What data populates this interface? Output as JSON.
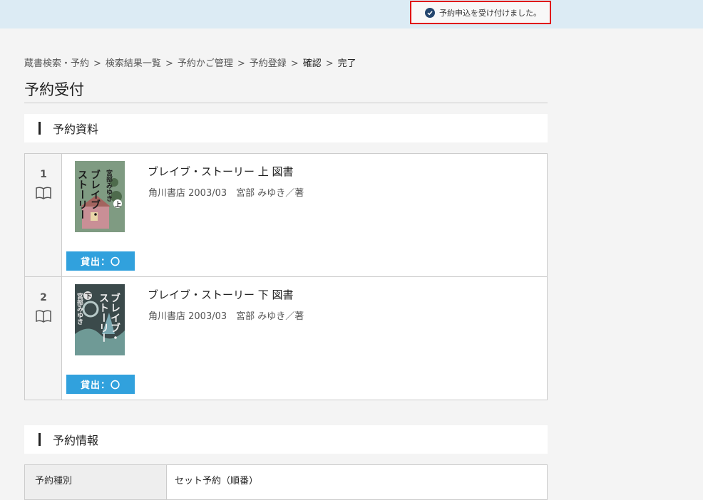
{
  "notice": {
    "message": "予約申込を受け付けました。",
    "icon": "check-circle-icon"
  },
  "breadcrumb": [
    {
      "label": "蔵書検索・予約",
      "current": false
    },
    {
      "label": "検索結果一覧",
      "current": false
    },
    {
      "label": "予約かご管理",
      "current": false
    },
    {
      "label": "予約登録",
      "current": false
    },
    {
      "label": "確認",
      "current": true
    },
    {
      "label": "完了",
      "current": true
    }
  ],
  "breadcrumb_separator": ">",
  "page_title": "予約受付",
  "sections": {
    "materials": "予約資料",
    "info": "予約情報"
  },
  "items": [
    {
      "number": "1",
      "title": "ブレイブ・ストーリー 上 図書",
      "meta": "角川書店 2003/03　宮部 みゆき／著",
      "availability": "貸出：〇",
      "cover": {
        "author": "宮部みゆき",
        "text": "ブレイブ・ストーリー",
        "volume": "上",
        "bg": "#6f8b73"
      }
    },
    {
      "number": "2",
      "title": "ブレイブ・ストーリー 下 図書",
      "meta": "角川書店 2003/03　宮部 みゆき／著",
      "availability": "貸出：〇",
      "cover": {
        "author": "宮部みゆき",
        "text": "ブレイブ・ストーリー",
        "volume": "下",
        "bg": "#3b4a4b"
      }
    }
  ],
  "reservation_info": {
    "type_label": "予約種別",
    "type_value": "セット予約（順番）"
  },
  "colors": {
    "accent": "#31a1dd",
    "notice_border": "#e01010",
    "topbar": "#dcebf4"
  }
}
